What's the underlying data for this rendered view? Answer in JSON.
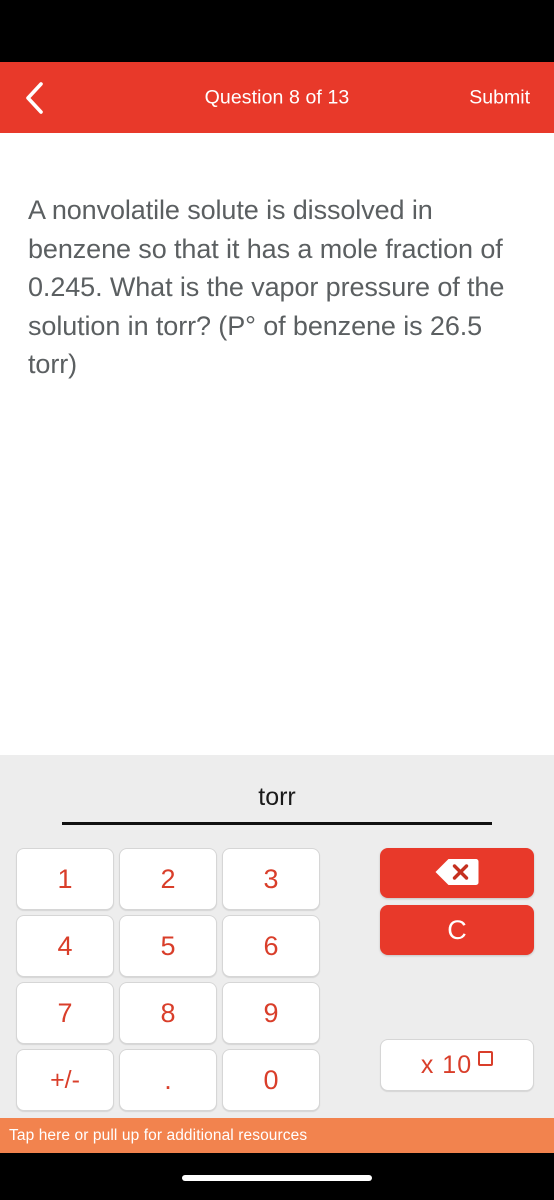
{
  "app": {
    "accent_color": "#E8392A",
    "key_text_color": "#d93e2a",
    "keypad_bg_color": "#ededed",
    "resources_bar_color": "#F2834E",
    "question_text_color": "#5b5f61"
  },
  "nav": {
    "back_icon": "chevron-left-icon",
    "title": "Question 8 of 13",
    "submit_label": "Submit"
  },
  "question": {
    "text": "A nonvolatile solute is dissolved in benzene so that it has a mole fraction of 0.245. What is the vapor pressure of the solution in torr? (P° of benzene is 26.5 torr)"
  },
  "answer": {
    "value": "",
    "unit": "torr"
  },
  "keypad": {
    "keys": [
      {
        "label": "1",
        "name": "key-1"
      },
      {
        "label": "2",
        "name": "key-2"
      },
      {
        "label": "3",
        "name": "key-3"
      },
      {
        "label": "4",
        "name": "key-4"
      },
      {
        "label": "5",
        "name": "key-5"
      },
      {
        "label": "6",
        "name": "key-6"
      },
      {
        "label": "7",
        "name": "key-7"
      },
      {
        "label": "8",
        "name": "key-8"
      },
      {
        "label": "9",
        "name": "key-9"
      },
      {
        "label": "+/-",
        "name": "key-sign"
      },
      {
        "label": ".",
        "name": "key-decimal"
      },
      {
        "label": "0",
        "name": "key-0"
      }
    ],
    "backspace_icon": "backspace-icon",
    "clear_label": "C",
    "exponent_label": "x 10"
  },
  "resources": {
    "label": "Tap here or pull up for additional resources"
  }
}
